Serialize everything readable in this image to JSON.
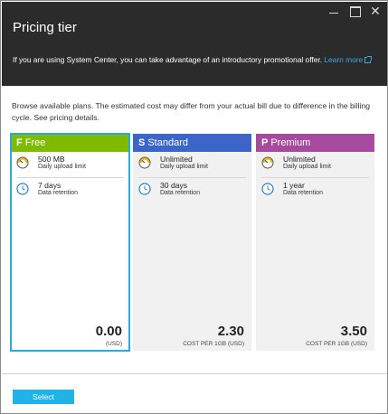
{
  "blade": {
    "title": "Pricing tier",
    "promo_text": "If you are using System Center, you can take advantage of an introductory promotional offer.",
    "learn_more": "Learn more",
    "intro": "Browse available plans. The estimated cost may differ from your actual bill due to difference in the billing cycle. See pricing details."
  },
  "colors": {
    "free": "#7fba00",
    "standard": "#3b66c7",
    "premium": "#a54a9c",
    "selection": "#29a8e0",
    "header_bg": "#2b2b2b"
  },
  "tiers": [
    {
      "letter": "F",
      "name": "Free",
      "upload_value": "500 MB",
      "upload_label": "Daily upload limit",
      "retention_value": "7 days",
      "retention_label": "Data retention",
      "price": "0.00",
      "unit": "(USD)"
    },
    {
      "letter": "S",
      "name": "Standard",
      "upload_value": "Unlimited",
      "upload_label": "Daily upload limit",
      "retention_value": "30 days",
      "retention_label": "Data retention",
      "price": "2.30",
      "unit": "COST PER 1GB (USD)"
    },
    {
      "letter": "P",
      "name": "Premium",
      "upload_value": "Unlimited",
      "upload_label": "Daily upload limit",
      "retention_value": "1 year",
      "retention_label": "Data retention",
      "price": "3.50",
      "unit": "COST PER 1GB (USD)"
    }
  ],
  "footer": {
    "select_label": "Select"
  }
}
